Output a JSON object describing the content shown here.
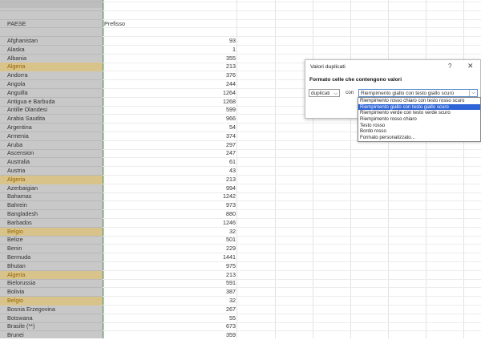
{
  "sheet": {
    "header_country": "PAESE",
    "header_prefix": "Prefisso",
    "rows": [
      {
        "country": "Afghanistan",
        "prefix": "93",
        "dup": false
      },
      {
        "country": "Alaska",
        "prefix": "1",
        "dup": false
      },
      {
        "country": "Albania",
        "prefix": "355",
        "dup": false
      },
      {
        "country": "Algeria",
        "prefix": "213",
        "dup": true
      },
      {
        "country": "Andorra",
        "prefix": "376",
        "dup": false
      },
      {
        "country": "Angola",
        "prefix": "244",
        "dup": false
      },
      {
        "country": "Anguilla",
        "prefix": "1264",
        "dup": false
      },
      {
        "country": "Antigua e Barbuda",
        "prefix": "1268",
        "dup": false
      },
      {
        "country": "Antille Olandesi",
        "prefix": "599",
        "dup": false
      },
      {
        "country": "Arabia Saudita",
        "prefix": "966",
        "dup": false
      },
      {
        "country": "Argentina",
        "prefix": "54",
        "dup": false
      },
      {
        "country": "Armenia",
        "prefix": "374",
        "dup": false
      },
      {
        "country": "Aruba",
        "prefix": "297",
        "dup": false
      },
      {
        "country": "Ascension",
        "prefix": "247",
        "dup": false
      },
      {
        "country": "Australia",
        "prefix": "61",
        "dup": false
      },
      {
        "country": "Austria",
        "prefix": "43",
        "dup": false
      },
      {
        "country": "Algeria",
        "prefix": "213",
        "dup": true
      },
      {
        "country": "Azerbaigian",
        "prefix": "994",
        "dup": false
      },
      {
        "country": "Bahamas",
        "prefix": "1242",
        "dup": false
      },
      {
        "country": "Bahrein",
        "prefix": "973",
        "dup": false
      },
      {
        "country": "Bangladesh",
        "prefix": "880",
        "dup": false
      },
      {
        "country": "Barbados",
        "prefix": "1246",
        "dup": false
      },
      {
        "country": "Belgio",
        "prefix": "32",
        "dup": true
      },
      {
        "country": "Belize",
        "prefix": "501",
        "dup": false
      },
      {
        "country": "Benin",
        "prefix": "229",
        "dup": false
      },
      {
        "country": "Bermuda",
        "prefix": "1441",
        "dup": false
      },
      {
        "country": "Bhutan",
        "prefix": "975",
        "dup": false
      },
      {
        "country": "Algeria",
        "prefix": "213",
        "dup": true
      },
      {
        "country": "Bielorussia",
        "prefix": "591",
        "dup": false
      },
      {
        "country": "Bolivia",
        "prefix": "387",
        "dup": false
      },
      {
        "country": "Belgio",
        "prefix": "32",
        "dup": true
      },
      {
        "country": "Bosnia Erzegovina",
        "prefix": "267",
        "dup": false
      },
      {
        "country": "Botswana",
        "prefix": "55",
        "dup": false
      },
      {
        "country": "Brasile (**)",
        "prefix": "673",
        "dup": false
      },
      {
        "country": "Brunei",
        "prefix": "359",
        "dup": false
      }
    ]
  },
  "dialog": {
    "title": "Valori duplicati",
    "help": "?",
    "close": "✕",
    "label": "Formato celle che contengono valori",
    "dup_value": "duplicati",
    "con_label": "con",
    "format_value": "Riempimento giallo con testo giallo scuro",
    "options": [
      "Riempimento rosso chiaro con testo rosso scuro",
      "Riempimento giallo con testo giallo scuro",
      "Riempimento verde con testo verde scuro",
      "Riempimento rosso chiaro",
      "Testo rosso",
      "Bordo rosso",
      "Formato personalizzato..."
    ],
    "selected_option_index": 1
  },
  "colors": {
    "highlight_fill": "#d8c48a",
    "highlight_text": "#9c6500",
    "selection_blue": "#2e64d6",
    "column_gray": "#c8c8c8"
  }
}
